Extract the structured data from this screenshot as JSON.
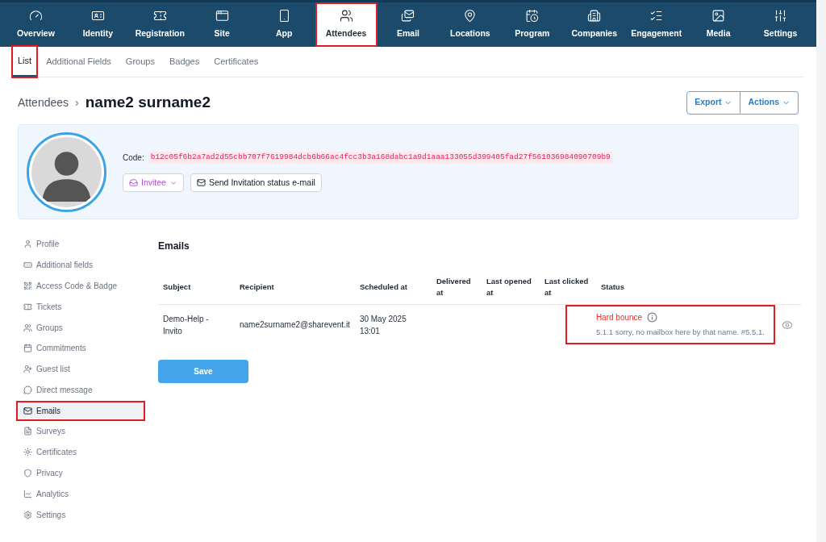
{
  "top_nav": [
    {
      "label": "Overview",
      "selected": false,
      "highlighted": false
    },
    {
      "label": "Identity",
      "selected": false,
      "highlighted": false
    },
    {
      "label": "Registration",
      "selected": false,
      "highlighted": false
    },
    {
      "label": "Site",
      "selected": false,
      "highlighted": false
    },
    {
      "label": "App",
      "selected": false,
      "highlighted": false
    },
    {
      "label": "Attendees",
      "selected": true,
      "highlighted": true
    },
    {
      "label": "Email",
      "selected": false,
      "highlighted": false
    },
    {
      "label": "Locations",
      "selected": false,
      "highlighted": false
    },
    {
      "label": "Program",
      "selected": false,
      "highlighted": false
    },
    {
      "label": "Companies",
      "selected": false,
      "highlighted": false
    },
    {
      "label": "Engagement",
      "selected": false,
      "highlighted": false
    },
    {
      "label": "Media",
      "selected": false,
      "highlighted": false
    },
    {
      "label": "Settings",
      "selected": false,
      "highlighted": false
    }
  ],
  "sub_tabs": [
    {
      "label": "List",
      "selected": true,
      "highlighted": true
    },
    {
      "label": "Additional Fields",
      "selected": false,
      "highlighted": false
    },
    {
      "label": "Groups",
      "selected": false,
      "highlighted": false
    },
    {
      "label": "Badges",
      "selected": false,
      "highlighted": false
    },
    {
      "label": "Certificates",
      "selected": false,
      "highlighted": false
    }
  ],
  "breadcrumb": {
    "parent": "Attendees",
    "separator": "›",
    "title": "name2 surname2"
  },
  "header_buttons": [
    "Export",
    "Actions"
  ],
  "profile": {
    "code_label": "Code:",
    "code": "b12c05f6b2a7ad2d55cbb707f7619984dcb6b66ac4fcc3b3a168dabc1a9d1aaa133055d399405fad27f561036984090709b9",
    "role": "Invitee",
    "send_button": "Send Invitation status e-mail"
  },
  "sidebar": [
    {
      "label": "Profile",
      "selected": false,
      "highlighted": false
    },
    {
      "label": "Additional fields",
      "selected": false,
      "highlighted": false
    },
    {
      "label": "Access Code & Badge",
      "selected": false,
      "highlighted": false
    },
    {
      "label": "Tickets",
      "selected": false,
      "highlighted": false
    },
    {
      "label": "Groups",
      "selected": false,
      "highlighted": false
    },
    {
      "label": "Commitments",
      "selected": false,
      "highlighted": false
    },
    {
      "label": "Guest list",
      "selected": false,
      "highlighted": false
    },
    {
      "label": "Direct message",
      "selected": false,
      "highlighted": false
    },
    {
      "label": "Emails",
      "selected": true,
      "highlighted": true
    },
    {
      "label": "Surveys",
      "selected": false,
      "highlighted": false
    },
    {
      "label": "Certificates",
      "selected": false,
      "highlighted": false
    },
    {
      "label": "Privacy",
      "selected": false,
      "highlighted": false
    },
    {
      "label": "Analytics",
      "selected": false,
      "highlighted": false
    },
    {
      "label": "Settings",
      "selected": false,
      "highlighted": false
    }
  ],
  "emails": {
    "title": "Emails",
    "columns": [
      "Subject",
      "Recipient",
      "Scheduled at",
      "Delivered at",
      "Last opened at",
      "Last clicked at",
      "Status"
    ],
    "rows": [
      {
        "subject": "Demo-Help - Invito",
        "recipient": "name2surname2@sharevent.it",
        "scheduled_at": "30 May 2025 13:01",
        "status": "Hard bounce",
        "status_detail": "5.1.1 sorry, no mailbox here by that name. #5.5.1.",
        "status_highlighted": true
      }
    ],
    "save_button": "Save"
  }
}
